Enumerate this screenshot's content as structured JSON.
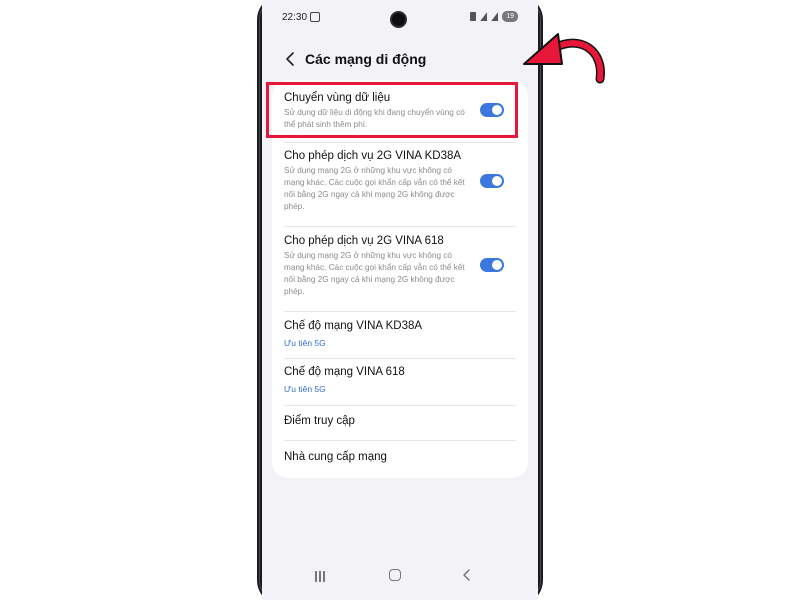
{
  "status_bar": {
    "time": "22:30",
    "battery": "19"
  },
  "header": {
    "title": "Các mạng di động"
  },
  "settings": [
    {
      "title": "Chuyển vùng dữ liệu",
      "description": "Sử dụng dữ liệu di động khi đang chuyển vùng có thể phát sinh thêm phí.",
      "toggle_on": true
    },
    {
      "title": "Cho phép dịch vụ 2G VINA KD38A",
      "description": "Sử dụng mạng 2G ở những khu vực không có mạng khác. Các cuộc gọi khẩn cấp vẫn có thể kết nối bằng 2G ngay cả khi mạng 2G không được phép.",
      "toggle_on": true
    },
    {
      "title": "Cho phép dịch vụ 2G VINA 618",
      "description": "Sử dụng mạng 2G ở những khu vực không có mạng khác. Các cuộc gọi khẩn cấp vẫn có thể kết nối bằng 2G ngay cả khi mạng 2G không được phép.",
      "toggle_on": true
    },
    {
      "title": "Chế độ mạng VINA KD38A",
      "subtitle": "Ưu tiên 5G"
    },
    {
      "title": "Chế độ mạng VINA 618",
      "subtitle": "Ưu tiên 5G"
    },
    {
      "title": "Điểm truy cập"
    },
    {
      "title": "Nhà cung cấp mạng"
    }
  ],
  "colors": {
    "accent": "#3a78e0",
    "link": "#2f6fd6",
    "annotation": "#e8173a"
  }
}
